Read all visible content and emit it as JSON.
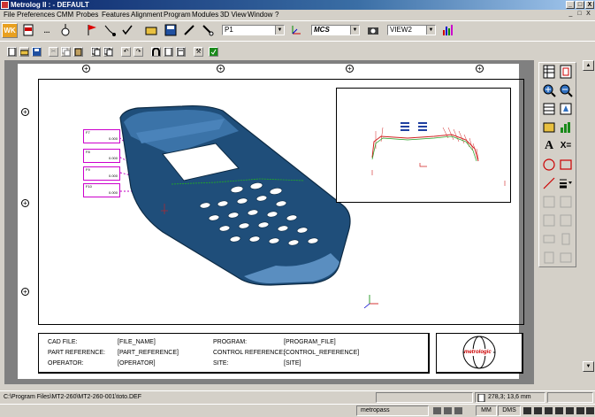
{
  "window": {
    "title": "Metrolog II : - DEFAULT",
    "min_glyph": "_",
    "max_glyph": "□",
    "close_glyph": "X"
  },
  "menu": {
    "items": [
      "File",
      "Preferences",
      "CMM",
      "Probes",
      "Features",
      "Alignment",
      "Program",
      "Modules",
      "3D View",
      "Window",
      "?"
    ],
    "mdi_min": "_",
    "mdi_restore": "□",
    "mdi_close": "X"
  },
  "toolbar1": {
    "wk_label": "WK",
    "dots_label": "...",
    "probe_select": "P1",
    "coord_select": "MCS",
    "view_select": "VIEW2"
  },
  "drawing": {
    "callouts": [
      {
        "tag": "F7",
        "val": "0.000"
      },
      {
        "tag": "F8",
        "val": "0.000"
      },
      {
        "tag": "F9",
        "val": "0.000"
      },
      {
        "tag": "F10",
        "val": "0.000"
      }
    ],
    "info": {
      "cad_file_label": "CAD FILE:",
      "cad_file_value": "[FILE_NAME]",
      "part_ref_label": "PART REFERENCE:",
      "part_ref_value": "[PART_REFERENCE]",
      "operator_label": "OPERATOR:",
      "operator_value": "[OPERATOR]",
      "program_label": "PROGRAM:",
      "program_value": "[PROGRAM_FILE]",
      "control_ref_label": "CONTROL REFERENCE:",
      "control_ref_value": "[CONTROL_REFERENCE]",
      "site_label": "SITE:",
      "site_value": "[SITE]"
    },
    "logo_text": "metrologic"
  },
  "rightbar": {
    "text_label": "A",
    "xeq_label": "X="
  },
  "statusbar": {
    "path": "C:\\Program Files\\MT2-260\\MT2-260-001\\toto.DEF",
    "coords": "278,3; 13,6 mm"
  },
  "taskbar": {
    "metropass": "metropass",
    "mm": "MM",
    "dms": "DMS"
  },
  "colors": {
    "titlebar": "#0a246a",
    "phone_body": "#1f4e7a",
    "callout_box": "#cc00cc"
  }
}
